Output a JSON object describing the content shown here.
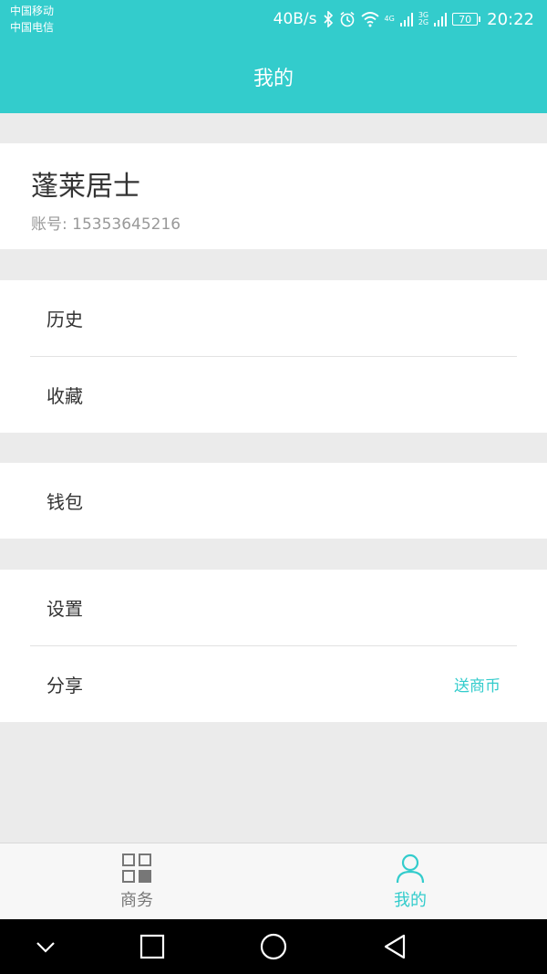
{
  "status_bar": {
    "carrier_1": "中国移动",
    "carrier_2": "中国电信",
    "network_speed": "40B/s",
    "tag_4g": "4G",
    "tag_3g": "3G",
    "tag_2g": "2G",
    "battery": "70",
    "time": "20:22"
  },
  "header": {
    "title": "我的"
  },
  "profile": {
    "name": "蓬莱居士",
    "account": "账号: 15353645216"
  },
  "menu": {
    "history": "历史",
    "favorites": "收藏",
    "wallet": "钱包",
    "settings": "设置",
    "share": "分享",
    "share_extra": "送商币"
  },
  "bottom_nav": {
    "business": "商务",
    "mine": "我的"
  },
  "colors": {
    "accent": "#33cccc",
    "background": "#ebebeb"
  }
}
